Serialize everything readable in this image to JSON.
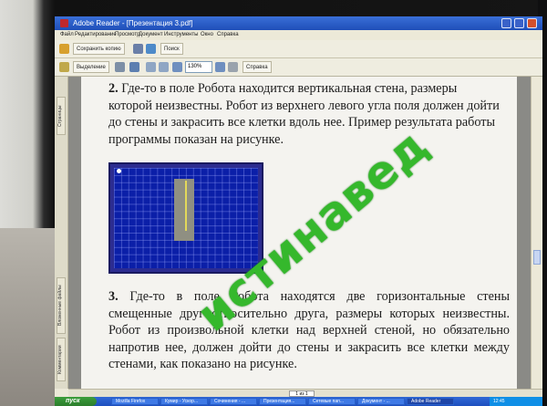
{
  "window": {
    "title": "Adobe Reader - [Презентация 3.pdf]"
  },
  "menu": [
    "Файл",
    "Редактирование",
    "Просмотр",
    "Документ",
    "Инструменты",
    "Окно",
    "Справка"
  ],
  "toolbar1": {
    "save_copy_label": "Сохранить копию",
    "search_label": "Поиск"
  },
  "toolbar2": {
    "select_label": "Выделение",
    "zoom_value": "130%",
    "help_label": "Справка"
  },
  "side_tabs": [
    "Страницы",
    "Вложенные файлы",
    "Комментарии"
  ],
  "task1": {
    "number": "2.",
    "text": "Где-то в поле Робота находится вертикальная стена, размеры которой неизвестны. Робот из верхнего левого угла поля должен дойти до стены и закрасить все клетки вдоль нее. Пример результата работы программы показан на рисунке."
  },
  "task2": {
    "number": "3.",
    "text": "Где-то в поле Робота находятся две горизонтальные стены смещенные друг относительно друга, размеры которых неизвестны. Робот из произвольной клетки над верхней стеной, но обязательно напротив нее, должен дойти до стены и закрасить все клетки между стенами, как показано на рисунке."
  },
  "status": {
    "page_indicator": "1 из 1"
  },
  "taskbar": {
    "start_label": "пуск",
    "items": [
      "Mozilla Firefox",
      "Кумир - Ускор...",
      "Сочинения - ...",
      "Презентация...",
      "Сетевые пап...",
      "Документ - ...",
      "Adobe Reader"
    ],
    "clock": "12:45"
  },
  "watermark": "истинавед",
  "colors": {
    "robot_field": "#0b1fa8",
    "painted_cells": "#8f8f82",
    "wall": "#e3d85a",
    "watermark": "#35b82c"
  }
}
